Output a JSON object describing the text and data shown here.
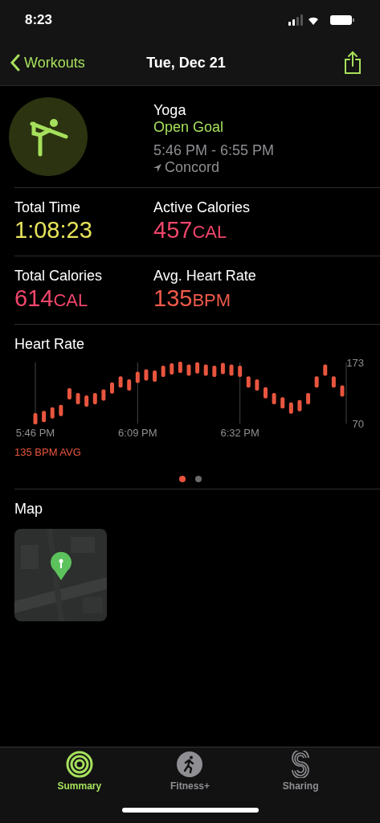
{
  "status_bar": {
    "time": "8:23"
  },
  "nav": {
    "back": "Workouts",
    "title": "Tue, Dec 21"
  },
  "workout": {
    "name": "Yoga",
    "goal": "Open Goal",
    "time_range": "5:46 PM - 6:55 PM",
    "location": "Concord"
  },
  "metrics": [
    {
      "label": "Total Time",
      "value": "1:08:23",
      "color": "#e6e25a"
    },
    {
      "label": "Active Calories",
      "value": "457",
      "unit": "CAL",
      "color": "#f0456a"
    },
    {
      "label": "Total Calories",
      "value": "614",
      "unit": "CAL",
      "color": "#f0456a"
    },
    {
      "label": "Avg. Heart Rate",
      "value": "135",
      "unit": "BPM",
      "color": "#f05a4a"
    }
  ],
  "heart_rate": {
    "title": "Heart Rate",
    "average": "135 BPM AVG",
    "chart_data": {
      "type": "scatter",
      "categories": [
        "5:46 PM",
        null,
        null,
        null,
        null,
        null,
        null,
        null,
        null,
        null,
        null,
        null,
        "6:09 PM",
        null,
        null,
        null,
        null,
        null,
        null,
        null,
        null,
        null,
        null,
        null,
        "6:32 PM",
        null,
        null,
        null,
        null,
        null,
        null,
        null,
        null,
        null,
        null,
        null,
        null
      ],
      "series": [
        {
          "color": "#e8553e",
          "values": [
            78,
            82,
            88,
            92,
            120,
            112,
            108,
            112,
            118,
            130,
            140,
            135,
            148,
            152,
            150,
            158,
            162,
            165,
            160,
            164,
            160,
            158,
            163,
            160,
            158,
            140,
            135,
            122,
            112,
            105,
            96,
            100,
            112,
            140,
            160,
            140,
            125
          ]
        }
      ],
      "ylim": [
        70,
        173
      ],
      "grid": true,
      "yticks": [
        70,
        173
      ]
    },
    "pages": [
      {
        "selected": true
      },
      {
        "selected": false
      }
    ]
  },
  "map": {
    "title": "Map"
  },
  "tabs": [
    {
      "label": "Summary",
      "selected": true,
      "kind": "rings"
    },
    {
      "label": "Fitness+",
      "selected": false,
      "kind": "runner"
    },
    {
      "label": "Sharing",
      "selected": false,
      "kind": "sharing"
    }
  ]
}
